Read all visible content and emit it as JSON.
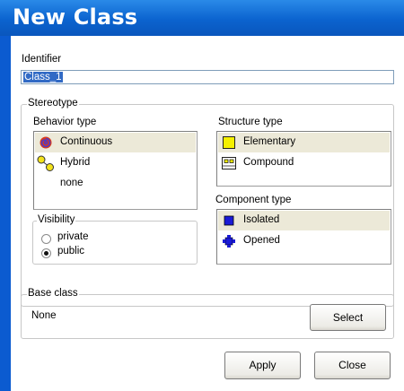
{
  "window": {
    "title": "New Class"
  },
  "identifier": {
    "label": "Identifier",
    "value": "Class_1"
  },
  "stereotype": {
    "legend": "Stereotype",
    "behavior_label": "Behavior type",
    "behavior_items": [
      {
        "label": "Continuous",
        "icon": "continuous-icon",
        "selected": true
      },
      {
        "label": "Hybrid",
        "icon": "hybrid-icon",
        "selected": false
      },
      {
        "label": "none",
        "icon": "",
        "selected": false
      }
    ],
    "structure_label": "Structure type",
    "structure_items": [
      {
        "label": "Elementary",
        "icon": "elementary-icon",
        "selected": true
      },
      {
        "label": "Compound",
        "icon": "compound-icon",
        "selected": false
      }
    ],
    "component_label": "Component type",
    "component_items": [
      {
        "label": "Isolated",
        "icon": "isolated-icon",
        "selected": true
      },
      {
        "label": "Opened",
        "icon": "opened-icon",
        "selected": false
      }
    ],
    "visibility": {
      "legend": "Visibility",
      "options": [
        {
          "label": "private",
          "checked": false
        },
        {
          "label": "public",
          "checked": true
        }
      ]
    }
  },
  "base_class": {
    "legend": "Base class",
    "value": "None",
    "select_label": "Select"
  },
  "buttons": {
    "apply": "Apply",
    "close": "Close"
  },
  "colors": {
    "titlebar": "#0b63cf",
    "selection": "#316ac5",
    "selected_row": "#ece9d8"
  }
}
